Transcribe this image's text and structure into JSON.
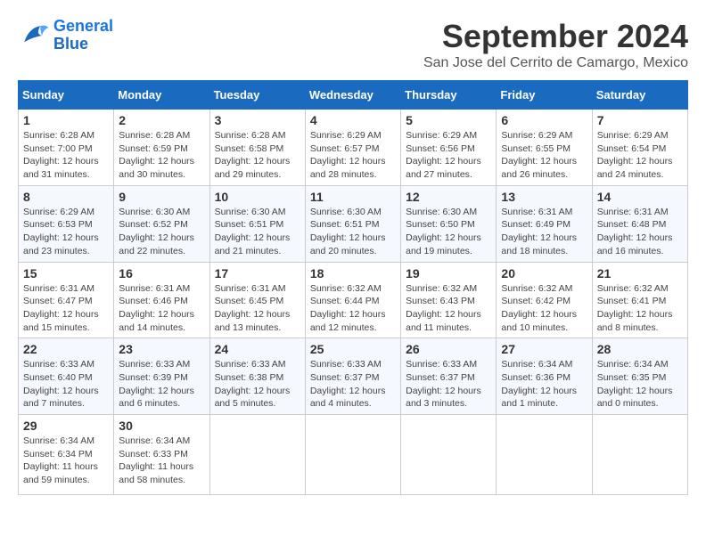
{
  "logo": {
    "line1": "General",
    "line2": "Blue"
  },
  "title": "September 2024",
  "location": "San Jose del Cerrito de Camargo, Mexico",
  "days_header": [
    "Sunday",
    "Monday",
    "Tuesday",
    "Wednesday",
    "Thursday",
    "Friday",
    "Saturday"
  ],
  "weeks": [
    [
      {
        "day": "1",
        "sunrise": "6:28 AM",
        "sunset": "7:00 PM",
        "daylight": "12 hours and 31 minutes."
      },
      {
        "day": "2",
        "sunrise": "6:28 AM",
        "sunset": "6:59 PM",
        "daylight": "12 hours and 30 minutes."
      },
      {
        "day": "3",
        "sunrise": "6:28 AM",
        "sunset": "6:58 PM",
        "daylight": "12 hours and 29 minutes."
      },
      {
        "day": "4",
        "sunrise": "6:29 AM",
        "sunset": "6:57 PM",
        "daylight": "12 hours and 28 minutes."
      },
      {
        "day": "5",
        "sunrise": "6:29 AM",
        "sunset": "6:56 PM",
        "daylight": "12 hours and 27 minutes."
      },
      {
        "day": "6",
        "sunrise": "6:29 AM",
        "sunset": "6:55 PM",
        "daylight": "12 hours and 26 minutes."
      },
      {
        "day": "7",
        "sunrise": "6:29 AM",
        "sunset": "6:54 PM",
        "daylight": "12 hours and 24 minutes."
      }
    ],
    [
      {
        "day": "8",
        "sunrise": "6:29 AM",
        "sunset": "6:53 PM",
        "daylight": "12 hours and 23 minutes."
      },
      {
        "day": "9",
        "sunrise": "6:30 AM",
        "sunset": "6:52 PM",
        "daylight": "12 hours and 22 minutes."
      },
      {
        "day": "10",
        "sunrise": "6:30 AM",
        "sunset": "6:51 PM",
        "daylight": "12 hours and 21 minutes."
      },
      {
        "day": "11",
        "sunrise": "6:30 AM",
        "sunset": "6:51 PM",
        "daylight": "12 hours and 20 minutes."
      },
      {
        "day": "12",
        "sunrise": "6:30 AM",
        "sunset": "6:50 PM",
        "daylight": "12 hours and 19 minutes."
      },
      {
        "day": "13",
        "sunrise": "6:31 AM",
        "sunset": "6:49 PM",
        "daylight": "12 hours and 18 minutes."
      },
      {
        "day": "14",
        "sunrise": "6:31 AM",
        "sunset": "6:48 PM",
        "daylight": "12 hours and 16 minutes."
      }
    ],
    [
      {
        "day": "15",
        "sunrise": "6:31 AM",
        "sunset": "6:47 PM",
        "daylight": "12 hours and 15 minutes."
      },
      {
        "day": "16",
        "sunrise": "6:31 AM",
        "sunset": "6:46 PM",
        "daylight": "12 hours and 14 minutes."
      },
      {
        "day": "17",
        "sunrise": "6:31 AM",
        "sunset": "6:45 PM",
        "daylight": "12 hours and 13 minutes."
      },
      {
        "day": "18",
        "sunrise": "6:32 AM",
        "sunset": "6:44 PM",
        "daylight": "12 hours and 12 minutes."
      },
      {
        "day": "19",
        "sunrise": "6:32 AM",
        "sunset": "6:43 PM",
        "daylight": "12 hours and 11 minutes."
      },
      {
        "day": "20",
        "sunrise": "6:32 AM",
        "sunset": "6:42 PM",
        "daylight": "12 hours and 10 minutes."
      },
      {
        "day": "21",
        "sunrise": "6:32 AM",
        "sunset": "6:41 PM",
        "daylight": "12 hours and 8 minutes."
      }
    ],
    [
      {
        "day": "22",
        "sunrise": "6:33 AM",
        "sunset": "6:40 PM",
        "daylight": "12 hours and 7 minutes."
      },
      {
        "day": "23",
        "sunrise": "6:33 AM",
        "sunset": "6:39 PM",
        "daylight": "12 hours and 6 minutes."
      },
      {
        "day": "24",
        "sunrise": "6:33 AM",
        "sunset": "6:38 PM",
        "daylight": "12 hours and 5 minutes."
      },
      {
        "day": "25",
        "sunrise": "6:33 AM",
        "sunset": "6:37 PM",
        "daylight": "12 hours and 4 minutes."
      },
      {
        "day": "26",
        "sunrise": "6:33 AM",
        "sunset": "6:37 PM",
        "daylight": "12 hours and 3 minutes."
      },
      {
        "day": "27",
        "sunrise": "6:34 AM",
        "sunset": "6:36 PM",
        "daylight": "12 hours and 1 minute."
      },
      {
        "day": "28",
        "sunrise": "6:34 AM",
        "sunset": "6:35 PM",
        "daylight": "12 hours and 0 minutes."
      }
    ],
    [
      {
        "day": "29",
        "sunrise": "6:34 AM",
        "sunset": "6:34 PM",
        "daylight": "11 hours and 59 minutes."
      },
      {
        "day": "30",
        "sunrise": "6:34 AM",
        "sunset": "6:33 PM",
        "daylight": "11 hours and 58 minutes."
      },
      null,
      null,
      null,
      null,
      null
    ]
  ]
}
